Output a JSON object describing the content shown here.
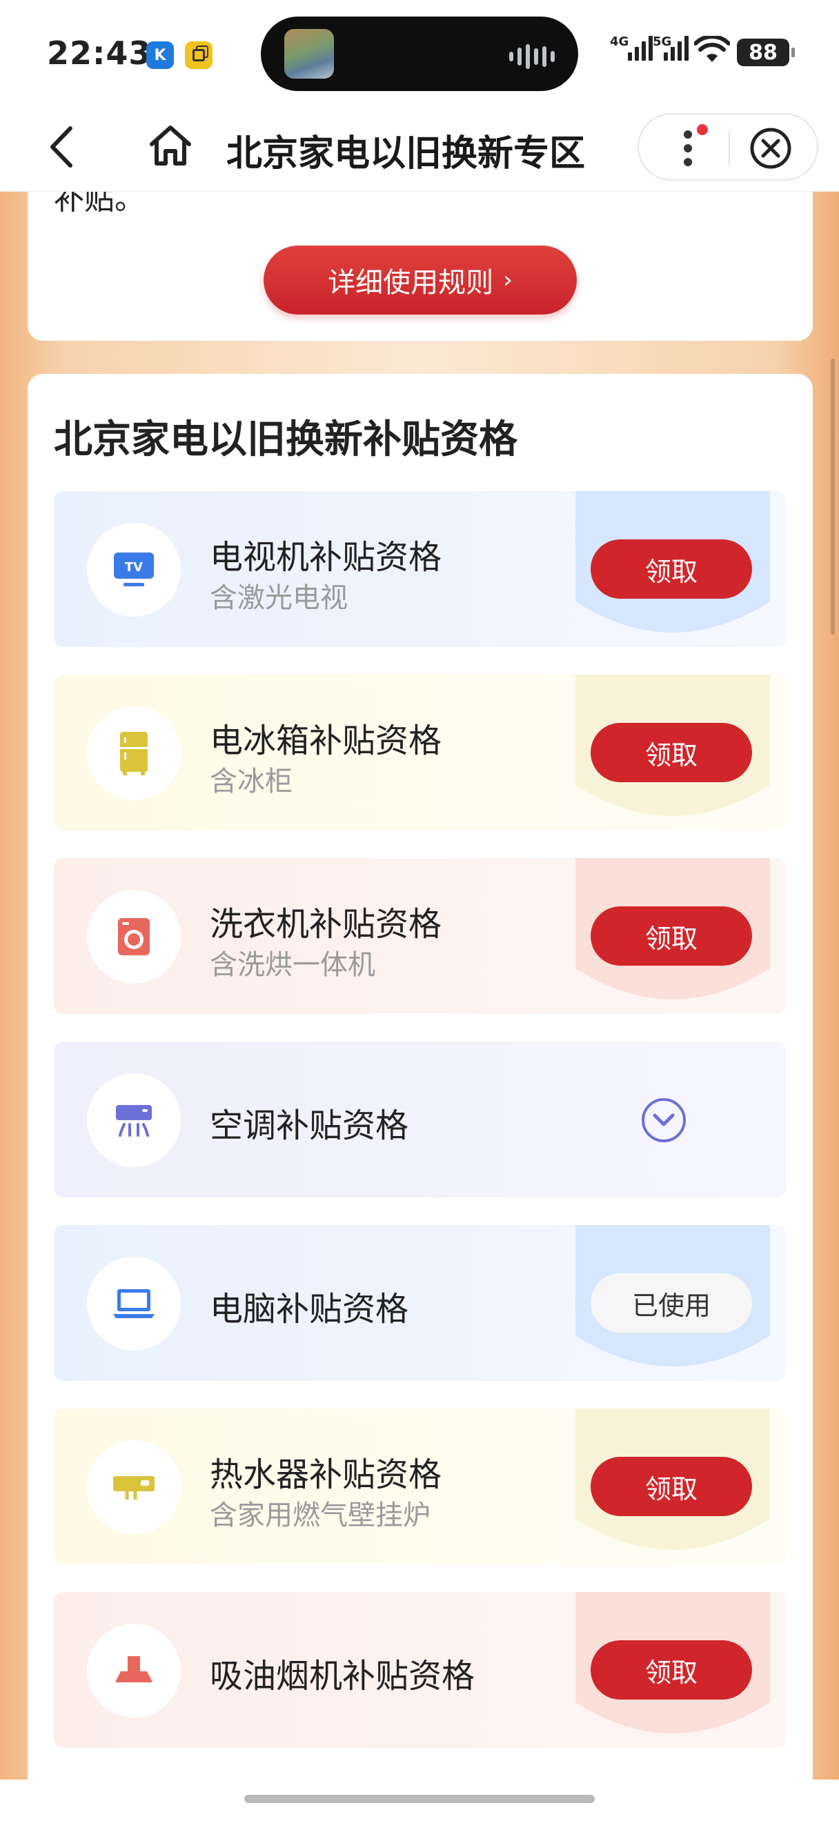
{
  "status_bar": {
    "time": "22:43",
    "badge_k": "K",
    "network_1": "4G",
    "network_2": "5G",
    "battery": "88"
  },
  "nav": {
    "title": "北京家电以旧换新专区"
  },
  "top_card": {
    "cut_text": "补贴。",
    "rules_button": "详细使用规则",
    "rules_chevron": "›"
  },
  "section": {
    "title": "北京家电以旧换新补贴资格"
  },
  "items": [
    {
      "title": "电视机补贴资格",
      "subtitle": "含激光电视",
      "action": "领取",
      "icon": "tv-icon"
    },
    {
      "title": "电冰箱补贴资格",
      "subtitle": "含冰柜",
      "action": "领取",
      "icon": "fridge-icon"
    },
    {
      "title": "洗衣机补贴资格",
      "subtitle": "含洗烘一体机",
      "action": "领取",
      "icon": "washer-icon"
    },
    {
      "title": "空调补贴资格",
      "subtitle": "",
      "action": "",
      "icon": "air-conditioner-icon"
    },
    {
      "title": "电脑补贴资格",
      "subtitle": "",
      "action": "已使用",
      "icon": "laptop-icon"
    },
    {
      "title": "热水器补贴资格",
      "subtitle": "含家用燃气壁挂炉",
      "action": "领取",
      "icon": "water-heater-icon"
    },
    {
      "title": "吸油烟机补贴资格",
      "subtitle": "",
      "action": "领取",
      "icon": "range-hood-icon"
    }
  ],
  "colors": {
    "accent_red": "#d0262b",
    "page_orange": "#f1b57f",
    "tv_blue": "#3b7be8",
    "fridge_yellow": "#d9c43b",
    "washer_red": "#e8675c",
    "ac_purple": "#6d6fd8"
  }
}
